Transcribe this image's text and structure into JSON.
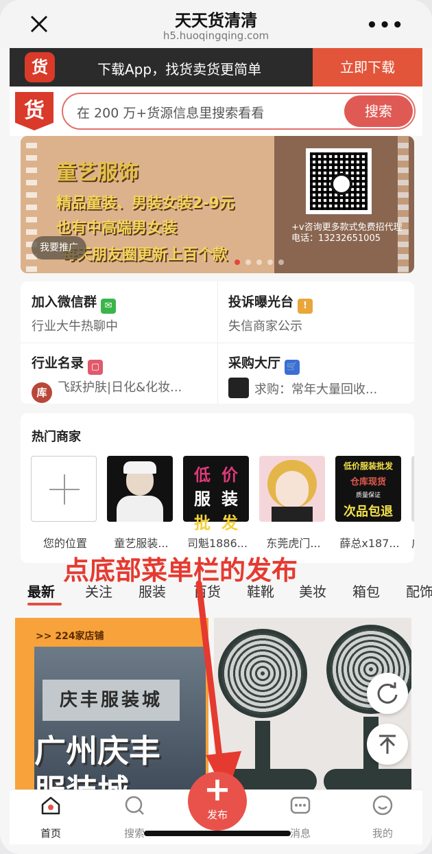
{
  "titlebar": {
    "title": "天天货清清",
    "url": "h5.huoqingqing.com"
  },
  "download_bar": {
    "logo_char": "货",
    "text": "下载App，找货卖货更简单",
    "button": "立即下载"
  },
  "search": {
    "logo_char": "货",
    "placeholder": "在 200 万+货源信息里搜索看看",
    "button": "搜索"
  },
  "banner": {
    "line1": "童艺服饰",
    "line2": "精品童装、男装女装2-9元",
    "line3": "也有中高端男女装",
    "line4": "每天朋友圈更新上百个款",
    "contact": "+v咨询更多款式免费招代理电话：13232651005",
    "tag": "我要推广"
  },
  "entries": [
    {
      "title": "加入微信群",
      "subtitle": "行业大牛热聊中",
      "icon": "wechat-icon",
      "icon_color": "#3bb54a"
    },
    {
      "title": "投诉曝光台",
      "subtitle": "失信商家公示",
      "icon": "alarm-icon",
      "icon_color": "#e9a63a"
    },
    {
      "title": "行业名录",
      "subtitle": "飞跃护肤|日化&化妆...",
      "icon": "book-icon",
      "icon_color": "#e05a6a",
      "avatar": "库"
    },
    {
      "title": "采购大厅",
      "subtitle": "求购：常年大量回收...",
      "icon": "cart-icon",
      "icon_color": "#3a6ed8"
    }
  ],
  "hot": {
    "title": "热门商家",
    "items": [
      {
        "label": "您的位置"
      },
      {
        "label": "童艺服装..."
      },
      {
        "label": "司魁1886..."
      },
      {
        "label": "东莞虎门..."
      },
      {
        "label": "薛总x187..."
      },
      {
        "label": "广"
      }
    ],
    "thumb3_text": [
      "低",
      "价",
      "服",
      "装",
      "批",
      "发"
    ],
    "thumb5_lines": [
      "低价服装批发",
      "仓库现货",
      "质量保证",
      "次品包退"
    ]
  },
  "annotation": "点底部菜单栏的发布",
  "tabs": [
    "最新",
    "关注",
    "服装",
    "百货",
    "鞋靴",
    "美妆",
    "箱包",
    "配饰"
  ],
  "feed": {
    "card1_badge": ">> 224家店铺",
    "card1_sign": "庆丰服装城",
    "card1_line1": "广州庆丰",
    "card1_line2": "服装城"
  },
  "bottom_nav": [
    {
      "label": "首页",
      "icon": "home-icon",
      "active": true
    },
    {
      "label": "搜索",
      "icon": "search-icon"
    },
    {
      "label": "发布",
      "icon": "plus-icon"
    },
    {
      "label": "消息",
      "icon": "message-icon"
    },
    {
      "label": "我的",
      "icon": "user-icon"
    }
  ],
  "colors": {
    "brand": "#d93a2a",
    "accent": "#e9524a",
    "annotation": "#e53a30"
  }
}
